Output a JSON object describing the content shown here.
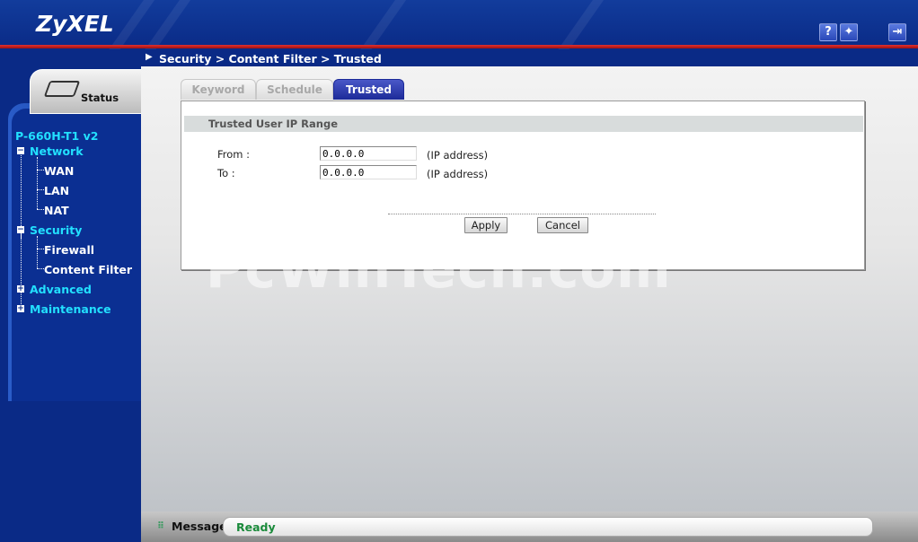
{
  "header": {
    "logo": "ZyXEL",
    "icons": [
      "help-icon",
      "wizard-icon",
      "logout-icon"
    ]
  },
  "breadcrumb": "Security > Content Filter > Trusted",
  "sidebar": {
    "status_tab": "Status",
    "model": "P-660H-T1 v2",
    "items": [
      {
        "label": "Network",
        "type": "category",
        "expanded": true
      },
      {
        "label": "WAN",
        "type": "sub"
      },
      {
        "label": "LAN",
        "type": "sub"
      },
      {
        "label": "NAT",
        "type": "sub"
      },
      {
        "label": "Security",
        "type": "category",
        "expanded": true
      },
      {
        "label": "Firewall",
        "type": "sub"
      },
      {
        "label": "Content Filter",
        "type": "sub"
      },
      {
        "label": "Advanced",
        "type": "category",
        "expanded": false
      },
      {
        "label": "Maintenance",
        "type": "category",
        "expanded": false
      }
    ]
  },
  "tabs": [
    {
      "label": "Keyword",
      "active": false
    },
    {
      "label": "Schedule",
      "active": false
    },
    {
      "label": "Trusted",
      "active": true
    }
  ],
  "form": {
    "section_title": "Trusted User IP Range",
    "from_label": "From :",
    "from_value": "0.0.0.0",
    "to_label": "To :",
    "to_value": "0.0.0.0",
    "hint": "(IP address)",
    "apply_label": "Apply",
    "cancel_label": "Cancel"
  },
  "watermark": "PcWinTech.com",
  "message": {
    "label": "Message",
    "status": "Ready"
  },
  "colors": {
    "brand_blue": "#0a2a86",
    "accent_red": "#c82020",
    "nav_category": "#22e0ff",
    "active_tab": "#2a3aa8",
    "status_green": "#1a8a3a"
  }
}
